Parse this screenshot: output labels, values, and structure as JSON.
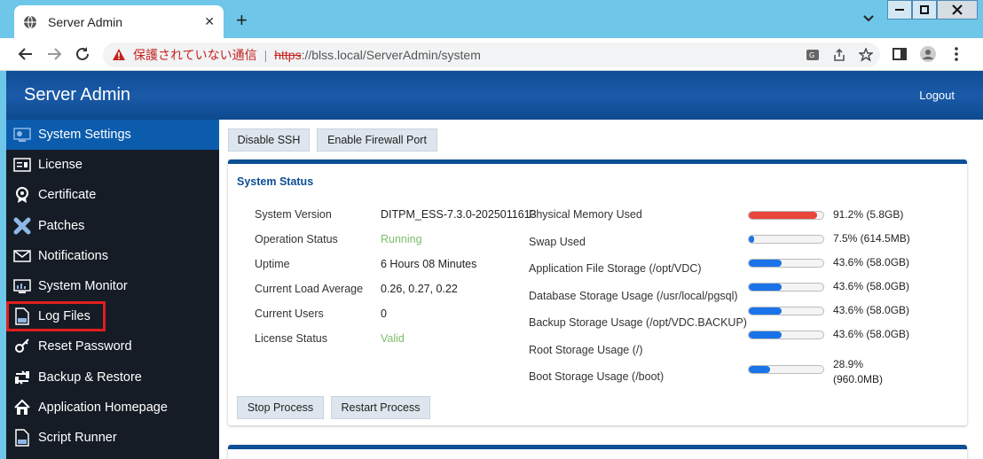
{
  "browser": {
    "tab_title": "Server Admin",
    "tab_close": "✕",
    "new_tab": "+",
    "security_warning": "保護されていない通信",
    "separator": "|",
    "url_scheme": "https",
    "url_rest": "://blss.local/ServerAdmin/system"
  },
  "header": {
    "title": "Server Admin",
    "logout": "Logout"
  },
  "sidebar": {
    "items": [
      {
        "label": "System Settings",
        "icon": "settings-icon"
      },
      {
        "label": "License",
        "icon": "license-icon"
      },
      {
        "label": "Certificate",
        "icon": "certificate-icon"
      },
      {
        "label": "Patches",
        "icon": "patch-icon"
      },
      {
        "label": "Notifications",
        "icon": "mail-icon"
      },
      {
        "label": "System Monitor",
        "icon": "monitor-icon"
      },
      {
        "label": "Log Files",
        "icon": "file-icon"
      },
      {
        "label": "Reset Password",
        "icon": "key-icon"
      },
      {
        "label": "Backup & Restore",
        "icon": "backup-icon"
      },
      {
        "label": "Application Homepage",
        "icon": "home-icon"
      },
      {
        "label": "Script Runner",
        "icon": "script-icon"
      }
    ]
  },
  "actions": {
    "disable_ssh": "Disable SSH",
    "enable_firewall": "Enable Firewall Port",
    "stop_process": "Stop Process",
    "restart_process": "Restart Process"
  },
  "status": {
    "title": "System Status",
    "rows": [
      {
        "label": "System Version",
        "value": "DITPM_ESS-7.3.0-2025011613"
      },
      {
        "label": "Operation Status",
        "value": "Running"
      },
      {
        "label": "Uptime",
        "value": "6 Hours 08 Minutes"
      },
      {
        "label": "Current Load Average",
        "value": "0.26, 0.27, 0.22"
      },
      {
        "label": "Current Users",
        "value": "0"
      },
      {
        "label": "License Status",
        "value": "Valid"
      }
    ],
    "resources": [
      {
        "label": "Physical Memory Used",
        "value": "91.2% (5.8GB)",
        "percent": 91.2
      },
      {
        "label": "Swap Used",
        "value": "7.5% (614.5MB)",
        "percent": 7.5
      },
      {
        "label": "Application File Storage (/opt/VDC)",
        "value": "43.6% (58.0GB)",
        "percent": 43.6
      },
      {
        "label": "Database Storage Usage (/usr/local/pgsql)",
        "value": "43.6% (58.0GB)",
        "percent": 43.6
      },
      {
        "label": "Backup Storage Usage (/opt/VDC.BACKUP)",
        "value": "43.6% (58.0GB)",
        "percent": 43.6
      },
      {
        "label": "Root Storage Usage (/)",
        "value": "43.6% (58.0GB)",
        "percent": 43.6
      },
      {
        "label": "Boot Storage Usage (/boot)",
        "value": "28.9%",
        "value2": "(960.0MB)",
        "percent": 28.9
      }
    ]
  },
  "colors": {
    "accent": "#0c4f95",
    "sidebar_bg": "#161c26",
    "active_item": "#0b5cad",
    "highlight_box": "#e01e1e",
    "status_green": "#7cbf6a",
    "bar_blue": "#1a73e8",
    "bar_red": "#e8453c"
  }
}
